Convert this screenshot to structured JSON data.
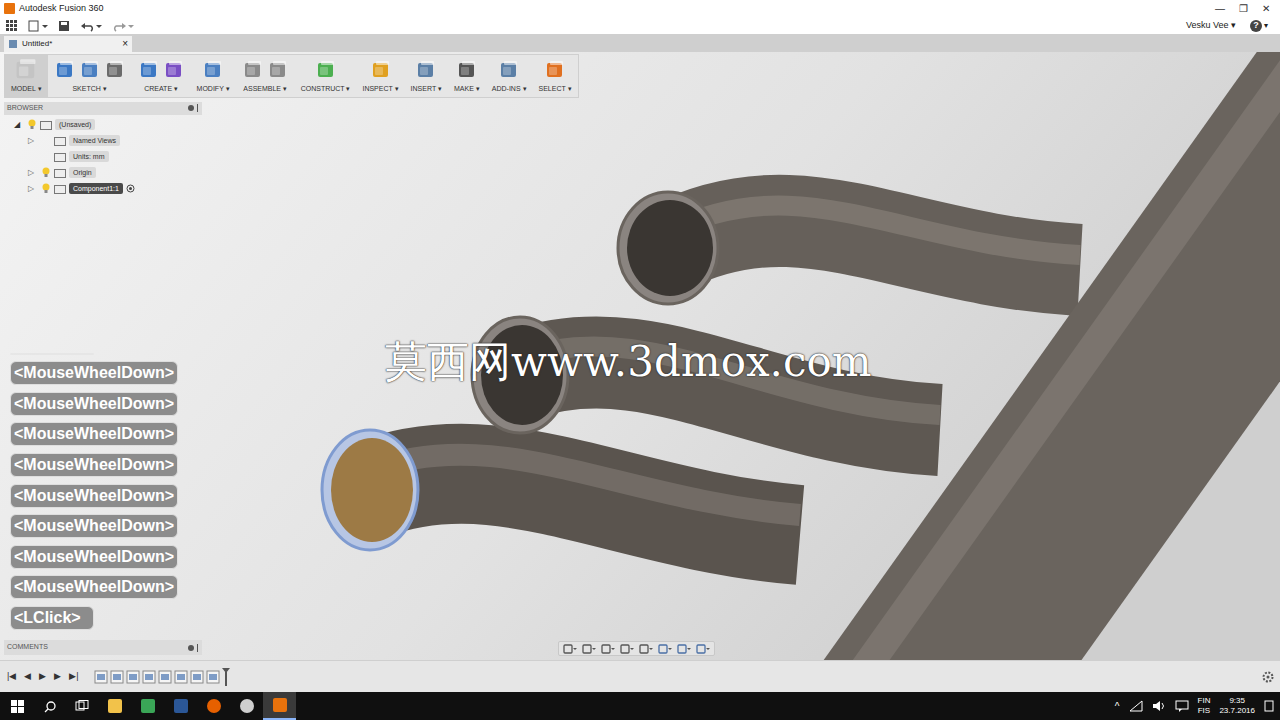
{
  "window": {
    "title": "Autodesk Fusion 360",
    "controls": [
      "—",
      "❐",
      "✕"
    ]
  },
  "quick_access": {
    "user": "Vesku Vee",
    "caret": "▾",
    "help": "?"
  },
  "document_tab": {
    "label": "Untitled*",
    "close": "×",
    "selected": true
  },
  "toolbar": {
    "caret": "▾",
    "groups": [
      {
        "label": "MODEL",
        "selected": true
      },
      {
        "label": "SKETCH",
        "selected": false
      },
      {
        "label": "CREATE",
        "selected": false
      },
      {
        "label": "MODIFY",
        "selected": false
      },
      {
        "label": "ASSEMBLE",
        "selected": false
      },
      {
        "label": "CONSTRUCT",
        "selected": false
      },
      {
        "label": "INSPECT",
        "selected": false
      },
      {
        "label": "INSERT",
        "selected": false
      },
      {
        "label": "MAKE",
        "selected": false
      },
      {
        "label": "ADD-INS",
        "selected": false
      },
      {
        "label": "SELECT",
        "selected": false
      }
    ]
  },
  "browser": {
    "title": "BROWSER",
    "items": [
      {
        "label": "(Unsaved)",
        "depth": 0,
        "expander": "◢",
        "expanded": true,
        "visible": true,
        "selected": false,
        "active": false
      },
      {
        "label": "Named Views",
        "depth": 1,
        "expander": "▷",
        "expanded": false,
        "visible": false,
        "selected": false,
        "active": false
      },
      {
        "label": "Units: mm",
        "depth": 1,
        "expander": "",
        "expanded": false,
        "visible": false,
        "selected": false,
        "active": false
      },
      {
        "label": "Origin",
        "depth": 1,
        "expander": "▷",
        "expanded": false,
        "visible": true,
        "selected": false,
        "active": false
      },
      {
        "label": "Component1:1",
        "depth": 1,
        "expander": "▷",
        "expanded": false,
        "visible": true,
        "selected": true,
        "active": true
      }
    ]
  },
  "viewport": {
    "openings": [
      {
        "selected": true
      },
      {
        "selected": false
      },
      {
        "selected": false
      }
    ]
  },
  "watermark": "莫西网www.3dmox.com",
  "keystrokes": [
    {
      "label": "",
      "faded": true
    },
    {
      "label": "<MouseWheelDown>",
      "faded": false
    },
    {
      "label": "<MouseWheelDown>",
      "faded": false
    },
    {
      "label": "<MouseWheelDown>",
      "faded": false
    },
    {
      "label": "<MouseWheelDown>",
      "faded": false
    },
    {
      "label": "<MouseWheelDown>",
      "faded": false
    },
    {
      "label": "<MouseWheelDown>",
      "faded": false
    },
    {
      "label": "<MouseWheelDown>",
      "faded": false
    },
    {
      "label": "<MouseWheelDown>",
      "faded": false
    },
    {
      "label": "<LClick>",
      "faded": false
    }
  ],
  "comments": {
    "title": "COMMENTS"
  },
  "timeline": {
    "controls": [
      "|◀",
      "◀",
      "▶",
      "▶",
      "▶|"
    ]
  },
  "taskbar": {
    "language": "FIN",
    "layout": "FIS",
    "time": "9:35",
    "date": "23.7.2016",
    "tray_caret": "^"
  }
}
